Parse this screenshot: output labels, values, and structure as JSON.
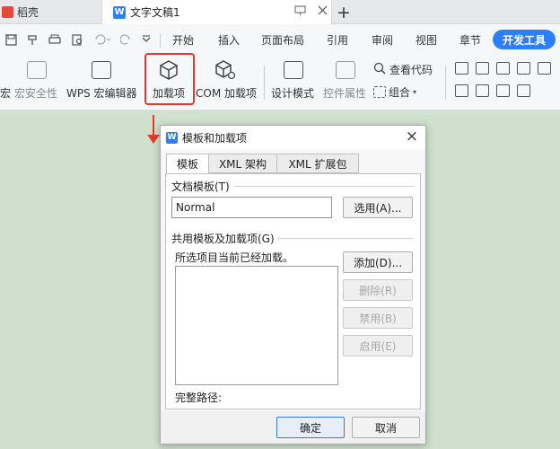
{
  "tabbar": {
    "app_tab_label": "稻壳",
    "doc_tab_label": "文字文稿1",
    "doc_tab_logo": "W",
    "new_tab_symbol": "+"
  },
  "menu": {
    "items": [
      {
        "label": "开始",
        "x": 0
      },
      {
        "label": "插入",
        "x": 0
      },
      {
        "label": "页面布局",
        "x": 0
      },
      {
        "label": "引用",
        "x": 0
      },
      {
        "label": "审阅",
        "x": 0
      },
      {
        "label": "视图",
        "x": 0
      },
      {
        "label": "章节",
        "x": 0
      }
    ],
    "active_label": "开发工具"
  },
  "ribbon": {
    "macro_label": "宏",
    "macro_security_label": "宏安全性",
    "wps_macro_editor_label": "WPS 宏编辑器",
    "addins_label": "加载项",
    "com_addins_label": "COM 加载项",
    "design_mode_label": "设计模式",
    "control_props_label": "控件属性",
    "view_code_label": "查看代码",
    "group_label": "组合"
  },
  "dialog": {
    "title": "模板和加载项",
    "close_symbol": "×",
    "tabs": [
      "模板",
      "XML 架构",
      "XML 扩展包"
    ],
    "document_template_label": "文档模板(T)",
    "template_value": "Normal",
    "choose_button": "选用(A)...",
    "global_templates_label": "共用模板及加载项(G)",
    "loaded_note": "所选项目当前已经加载。",
    "add_button": "添加(D)...",
    "delete_button": "删除(R)",
    "disable_button": "禁用(B)",
    "enable_button": "启用(E)",
    "full_path_label": "完整路径:",
    "ok_button": "确定",
    "cancel_button": "取消"
  },
  "colors": {
    "accent": "#2d7ff9",
    "highlight": "#e23b2e",
    "page_background": "#cfe0cd"
  }
}
